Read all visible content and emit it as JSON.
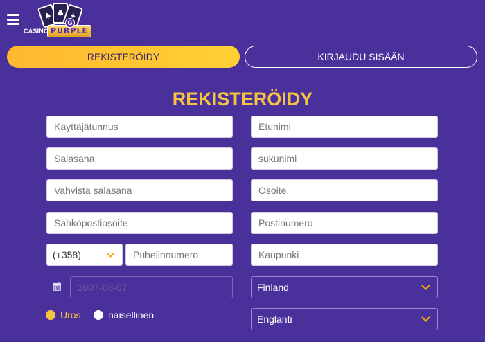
{
  "header": {
    "logo": {
      "casino_text": "CASINO",
      "purple_text": "PURPLE",
      "g_badge": "G"
    }
  },
  "tabs": {
    "register_label": "REKISTERÖIDY",
    "login_label": "KIRJAUDU SISÄÄN"
  },
  "form": {
    "title": "REKISTERÖIDY",
    "left": {
      "username_placeholder": "Käyttäjätunnus",
      "password_placeholder": "Salasana",
      "confirm_password_placeholder": "Vahvista salasana",
      "email_placeholder": "Sähköpostiosoite",
      "phone_prefix": "(+358)",
      "phone_placeholder": "Puhelinnumero",
      "birthdate_value": "2007-08-07"
    },
    "right": {
      "firstname_placeholder": "Etunimi",
      "lastname_placeholder": "sukunimi",
      "address_placeholder": "Osoite",
      "postcode_placeholder": "Postinumero",
      "city_placeholder": "Kaupunki",
      "country_selected": "Finland",
      "language_selected": "Englanti"
    },
    "gender": {
      "male_label": "Uros",
      "female_label": "naisellinen",
      "selected": "male"
    }
  },
  "colors": {
    "background": "#4a309a",
    "accent": "#f6c343",
    "tab_gradient_start": "#ffb830",
    "tab_gradient_end": "#ffd133"
  },
  "icons": {
    "menu": "hamburger-icon",
    "calendar": "calendar-icon",
    "dropdown": "chevron-down-icon"
  }
}
